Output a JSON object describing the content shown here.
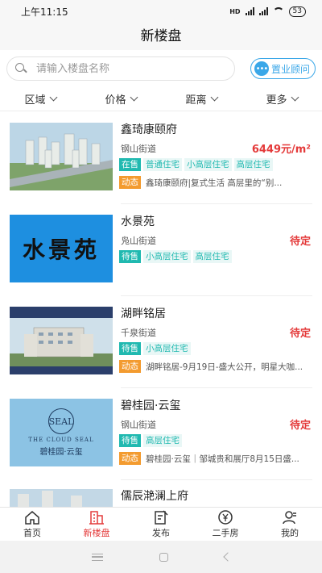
{
  "status_bar": {
    "time": "上午11:15",
    "network": "HD",
    "battery": "53"
  },
  "header": {
    "title": "新楼盘"
  },
  "search": {
    "placeholder": "请输入楼盘名称",
    "advisor_label": "置业顾问"
  },
  "filters": [
    {
      "label": "区域"
    },
    {
      "label": "价格"
    },
    {
      "label": "距离"
    },
    {
      "label": "更多"
    }
  ],
  "listings": [
    {
      "name": "鑫琦康颐府",
      "street": "钢山街道",
      "price": "6449元/m²",
      "tags": [
        "在售",
        "普通住宅",
        "小高层住宅",
        "高层住宅"
      ],
      "news_badge": "动态",
      "news": "鑫琦康颐府|复式生活 高层里的“别..."
    },
    {
      "name": "水景苑",
      "street": "凫山街道",
      "price": "待定",
      "image_text": "水景苑",
      "tags": [
        "待售",
        "小高层住宅",
        "高层住宅"
      ]
    },
    {
      "name": "湖畔铭居",
      "street": "千泉街道",
      "price": "待定",
      "tags": [
        "待售",
        "小高层住宅"
      ],
      "news_badge": "动态",
      "news": "湖畔铭居-9月19日-盛大公开，明星大咖..."
    },
    {
      "name": "碧桂园·云玺",
      "street": "钢山街道",
      "price": "待定",
      "image_logo": "SEAL",
      "image_text_en": "THE CLOUD SEAL",
      "image_text": "碧桂园·云玺",
      "tags": [
        "待售",
        "高层住宅"
      ],
      "news_badge": "动态",
      "news": "碧桂园·云玺｜邹城贵和展厅8月15日盛..."
    },
    {
      "name": "儒辰滟澜上府"
    }
  ],
  "tab_bar": [
    {
      "label": "首页",
      "icon": "home-icon"
    },
    {
      "label": "新楼盘",
      "icon": "building-icon",
      "active": true
    },
    {
      "label": "发布",
      "icon": "publish-icon"
    },
    {
      "label": "二手房",
      "icon": "yuan-icon"
    },
    {
      "label": "我的",
      "icon": "user-icon"
    }
  ],
  "colors": {
    "accent_red": "#e43a3a",
    "tag_teal": "#20b9b0",
    "news_orange": "#f39b2f",
    "advisor_blue": "#3aa7e8"
  }
}
